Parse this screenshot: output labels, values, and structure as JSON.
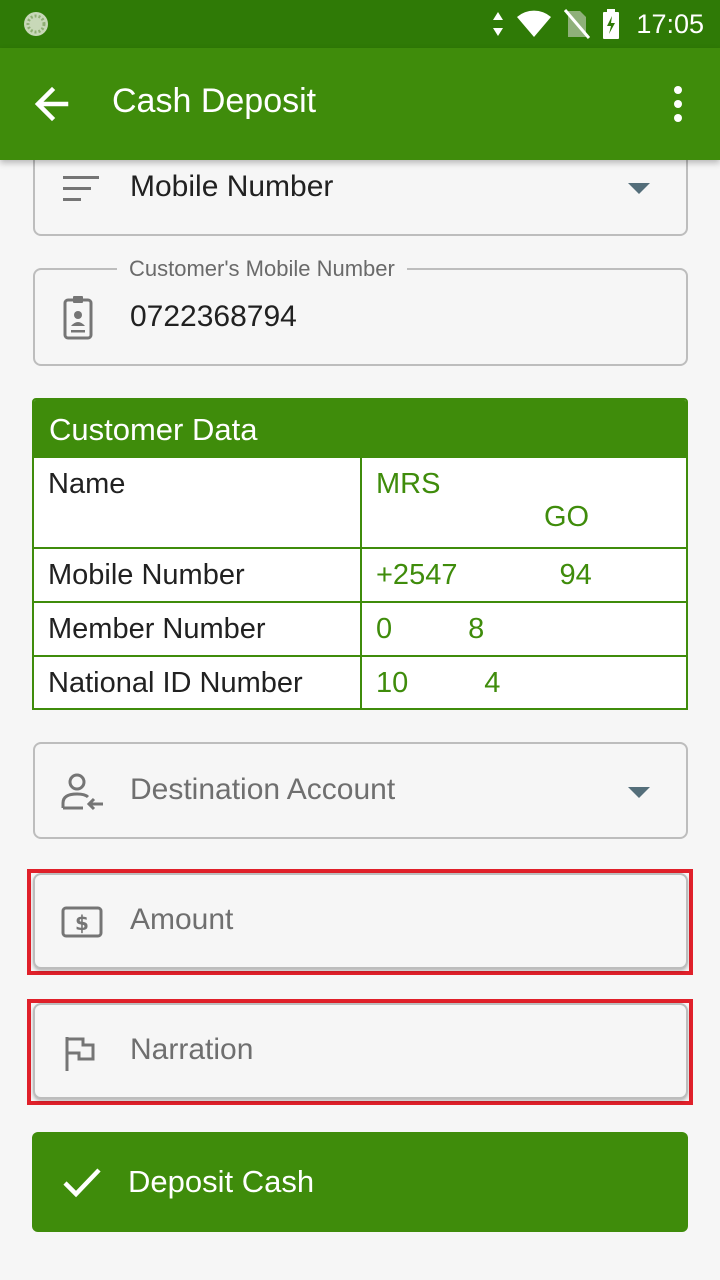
{
  "status_bar": {
    "time": "17:05"
  },
  "app_bar": {
    "title": "Cash Deposit"
  },
  "form": {
    "id_type": {
      "value": "Mobile Number"
    },
    "mobile": {
      "label": "Customer's Mobile Number",
      "value": "0722368794"
    },
    "destination": {
      "placeholder": "Destination Account"
    },
    "amount": {
      "placeholder": "Amount"
    },
    "narration": {
      "placeholder": "Narration"
    }
  },
  "customer_data": {
    "title": "Customer Data",
    "rows": [
      {
        "label": "Name",
        "value_line1": "MRS",
        "value_line2": "GO"
      },
      {
        "label": "Mobile Number",
        "value_start": "+2547",
        "value_end": "94"
      },
      {
        "label": "Member Number",
        "value_start": "0",
        "value_end": "8"
      },
      {
        "label": "National ID Number",
        "value_start": "10",
        "value_end": "4"
      }
    ]
  },
  "submit": {
    "label": "Deposit Cash"
  },
  "colors": {
    "primary": "#3f8c0b",
    "status": "#2f7a06",
    "highlight": "#e0202a"
  }
}
